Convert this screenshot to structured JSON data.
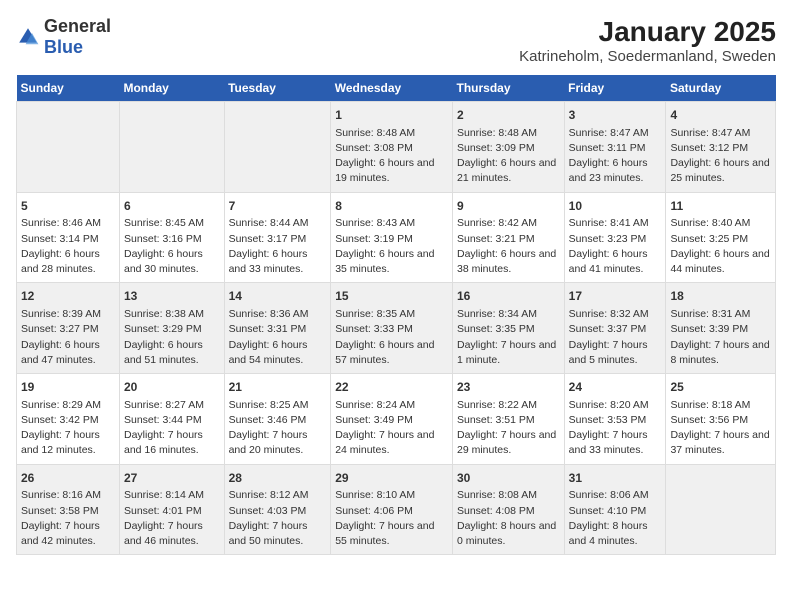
{
  "header": {
    "logo_general": "General",
    "logo_blue": "Blue",
    "title": "January 2025",
    "location": "Katrineholm, Soedermanland, Sweden"
  },
  "weekdays": [
    "Sunday",
    "Monday",
    "Tuesday",
    "Wednesday",
    "Thursday",
    "Friday",
    "Saturday"
  ],
  "weeks": [
    [
      {
        "day": "",
        "text": ""
      },
      {
        "day": "",
        "text": ""
      },
      {
        "day": "",
        "text": ""
      },
      {
        "day": "1",
        "text": "Sunrise: 8:48 AM\nSunset: 3:08 PM\nDaylight: 6 hours\nand 19 minutes."
      },
      {
        "day": "2",
        "text": "Sunrise: 8:48 AM\nSunset: 3:09 PM\nDaylight: 6 hours\nand 21 minutes."
      },
      {
        "day": "3",
        "text": "Sunrise: 8:47 AM\nSunset: 3:11 PM\nDaylight: 6 hours\nand 23 minutes."
      },
      {
        "day": "4",
        "text": "Sunrise: 8:47 AM\nSunset: 3:12 PM\nDaylight: 6 hours\nand 25 minutes."
      }
    ],
    [
      {
        "day": "5",
        "text": "Sunrise: 8:46 AM\nSunset: 3:14 PM\nDaylight: 6 hours\nand 28 minutes."
      },
      {
        "day": "6",
        "text": "Sunrise: 8:45 AM\nSunset: 3:16 PM\nDaylight: 6 hours\nand 30 minutes."
      },
      {
        "day": "7",
        "text": "Sunrise: 8:44 AM\nSunset: 3:17 PM\nDaylight: 6 hours\nand 33 minutes."
      },
      {
        "day": "8",
        "text": "Sunrise: 8:43 AM\nSunset: 3:19 PM\nDaylight: 6 hours\nand 35 minutes."
      },
      {
        "day": "9",
        "text": "Sunrise: 8:42 AM\nSunset: 3:21 PM\nDaylight: 6 hours\nand 38 minutes."
      },
      {
        "day": "10",
        "text": "Sunrise: 8:41 AM\nSunset: 3:23 PM\nDaylight: 6 hours\nand 41 minutes."
      },
      {
        "day": "11",
        "text": "Sunrise: 8:40 AM\nSunset: 3:25 PM\nDaylight: 6 hours\nand 44 minutes."
      }
    ],
    [
      {
        "day": "12",
        "text": "Sunrise: 8:39 AM\nSunset: 3:27 PM\nDaylight: 6 hours\nand 47 minutes."
      },
      {
        "day": "13",
        "text": "Sunrise: 8:38 AM\nSunset: 3:29 PM\nDaylight: 6 hours\nand 51 minutes."
      },
      {
        "day": "14",
        "text": "Sunrise: 8:36 AM\nSunset: 3:31 PM\nDaylight: 6 hours\nand 54 minutes."
      },
      {
        "day": "15",
        "text": "Sunrise: 8:35 AM\nSunset: 3:33 PM\nDaylight: 6 hours\nand 57 minutes."
      },
      {
        "day": "16",
        "text": "Sunrise: 8:34 AM\nSunset: 3:35 PM\nDaylight: 7 hours\nand 1 minute."
      },
      {
        "day": "17",
        "text": "Sunrise: 8:32 AM\nSunset: 3:37 PM\nDaylight: 7 hours\nand 5 minutes."
      },
      {
        "day": "18",
        "text": "Sunrise: 8:31 AM\nSunset: 3:39 PM\nDaylight: 7 hours\nand 8 minutes."
      }
    ],
    [
      {
        "day": "19",
        "text": "Sunrise: 8:29 AM\nSunset: 3:42 PM\nDaylight: 7 hours\nand 12 minutes."
      },
      {
        "day": "20",
        "text": "Sunrise: 8:27 AM\nSunset: 3:44 PM\nDaylight: 7 hours\nand 16 minutes."
      },
      {
        "day": "21",
        "text": "Sunrise: 8:25 AM\nSunset: 3:46 PM\nDaylight: 7 hours\nand 20 minutes."
      },
      {
        "day": "22",
        "text": "Sunrise: 8:24 AM\nSunset: 3:49 PM\nDaylight: 7 hours\nand 24 minutes."
      },
      {
        "day": "23",
        "text": "Sunrise: 8:22 AM\nSunset: 3:51 PM\nDaylight: 7 hours\nand 29 minutes."
      },
      {
        "day": "24",
        "text": "Sunrise: 8:20 AM\nSunset: 3:53 PM\nDaylight: 7 hours\nand 33 minutes."
      },
      {
        "day": "25",
        "text": "Sunrise: 8:18 AM\nSunset: 3:56 PM\nDaylight: 7 hours\nand 37 minutes."
      }
    ],
    [
      {
        "day": "26",
        "text": "Sunrise: 8:16 AM\nSunset: 3:58 PM\nDaylight: 7 hours\nand 42 minutes."
      },
      {
        "day": "27",
        "text": "Sunrise: 8:14 AM\nSunset: 4:01 PM\nDaylight: 7 hours\nand 46 minutes."
      },
      {
        "day": "28",
        "text": "Sunrise: 8:12 AM\nSunset: 4:03 PM\nDaylight: 7 hours\nand 50 minutes."
      },
      {
        "day": "29",
        "text": "Sunrise: 8:10 AM\nSunset: 4:06 PM\nDaylight: 7 hours\nand 55 minutes."
      },
      {
        "day": "30",
        "text": "Sunrise: 8:08 AM\nSunset: 4:08 PM\nDaylight: 8 hours\nand 0 minutes."
      },
      {
        "day": "31",
        "text": "Sunrise: 8:06 AM\nSunset: 4:10 PM\nDaylight: 8 hours\nand 4 minutes."
      },
      {
        "day": "",
        "text": ""
      }
    ]
  ]
}
